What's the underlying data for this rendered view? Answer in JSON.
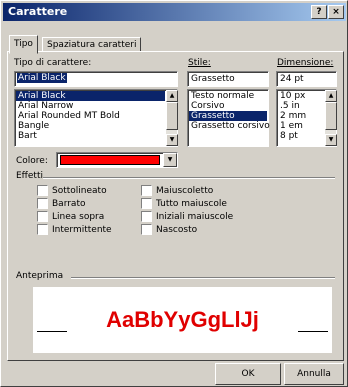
{
  "window": {
    "title": "Carattere",
    "help_label": "?",
    "close_label": "×"
  },
  "tabs": [
    {
      "label": "Tipo",
      "active": true
    },
    {
      "label": "Spaziatura caratteri",
      "active": false
    }
  ],
  "font": {
    "label": "Tipo di carattere:",
    "value": "Arial Black",
    "items": [
      "Arial Black",
      "Arial Narrow",
      "Arial Rounded MT Bold",
      "Bangle",
      "Bart"
    ],
    "selected_index": 0
  },
  "style": {
    "label": "Stile:",
    "value": "Grassetto",
    "items": [
      "Testo normale",
      "Corsivo",
      "Grassetto",
      "Grassetto corsivo"
    ],
    "selected_index": 2
  },
  "size": {
    "label": "Dimensione:",
    "value": "24 pt",
    "items": [
      "10 px",
      ".5 in",
      "2 mm",
      "1 em",
      "8 pt"
    ]
  },
  "color": {
    "label": "Colore:",
    "value_hex": "#ff0000"
  },
  "effects": {
    "label": "Effetti",
    "left": [
      "Sottolineato",
      "Barrato",
      "Linea sopra",
      "Intermittente"
    ],
    "right": [
      "Maiuscoletto",
      "Tutto maiuscole",
      "Iniziali maiuscole",
      "Nascosto"
    ]
  },
  "preview": {
    "label": "Anteprima",
    "sample_text": "AaBbYyGgLlJj",
    "text_color": "#e00000"
  },
  "buttons": {
    "ok": "OK",
    "cancel": "Annulla"
  },
  "icons": {
    "scroll_up": "arrow-up-icon",
    "scroll_down": "arrow-down-icon",
    "dropdown": "chevron-down-icon"
  }
}
